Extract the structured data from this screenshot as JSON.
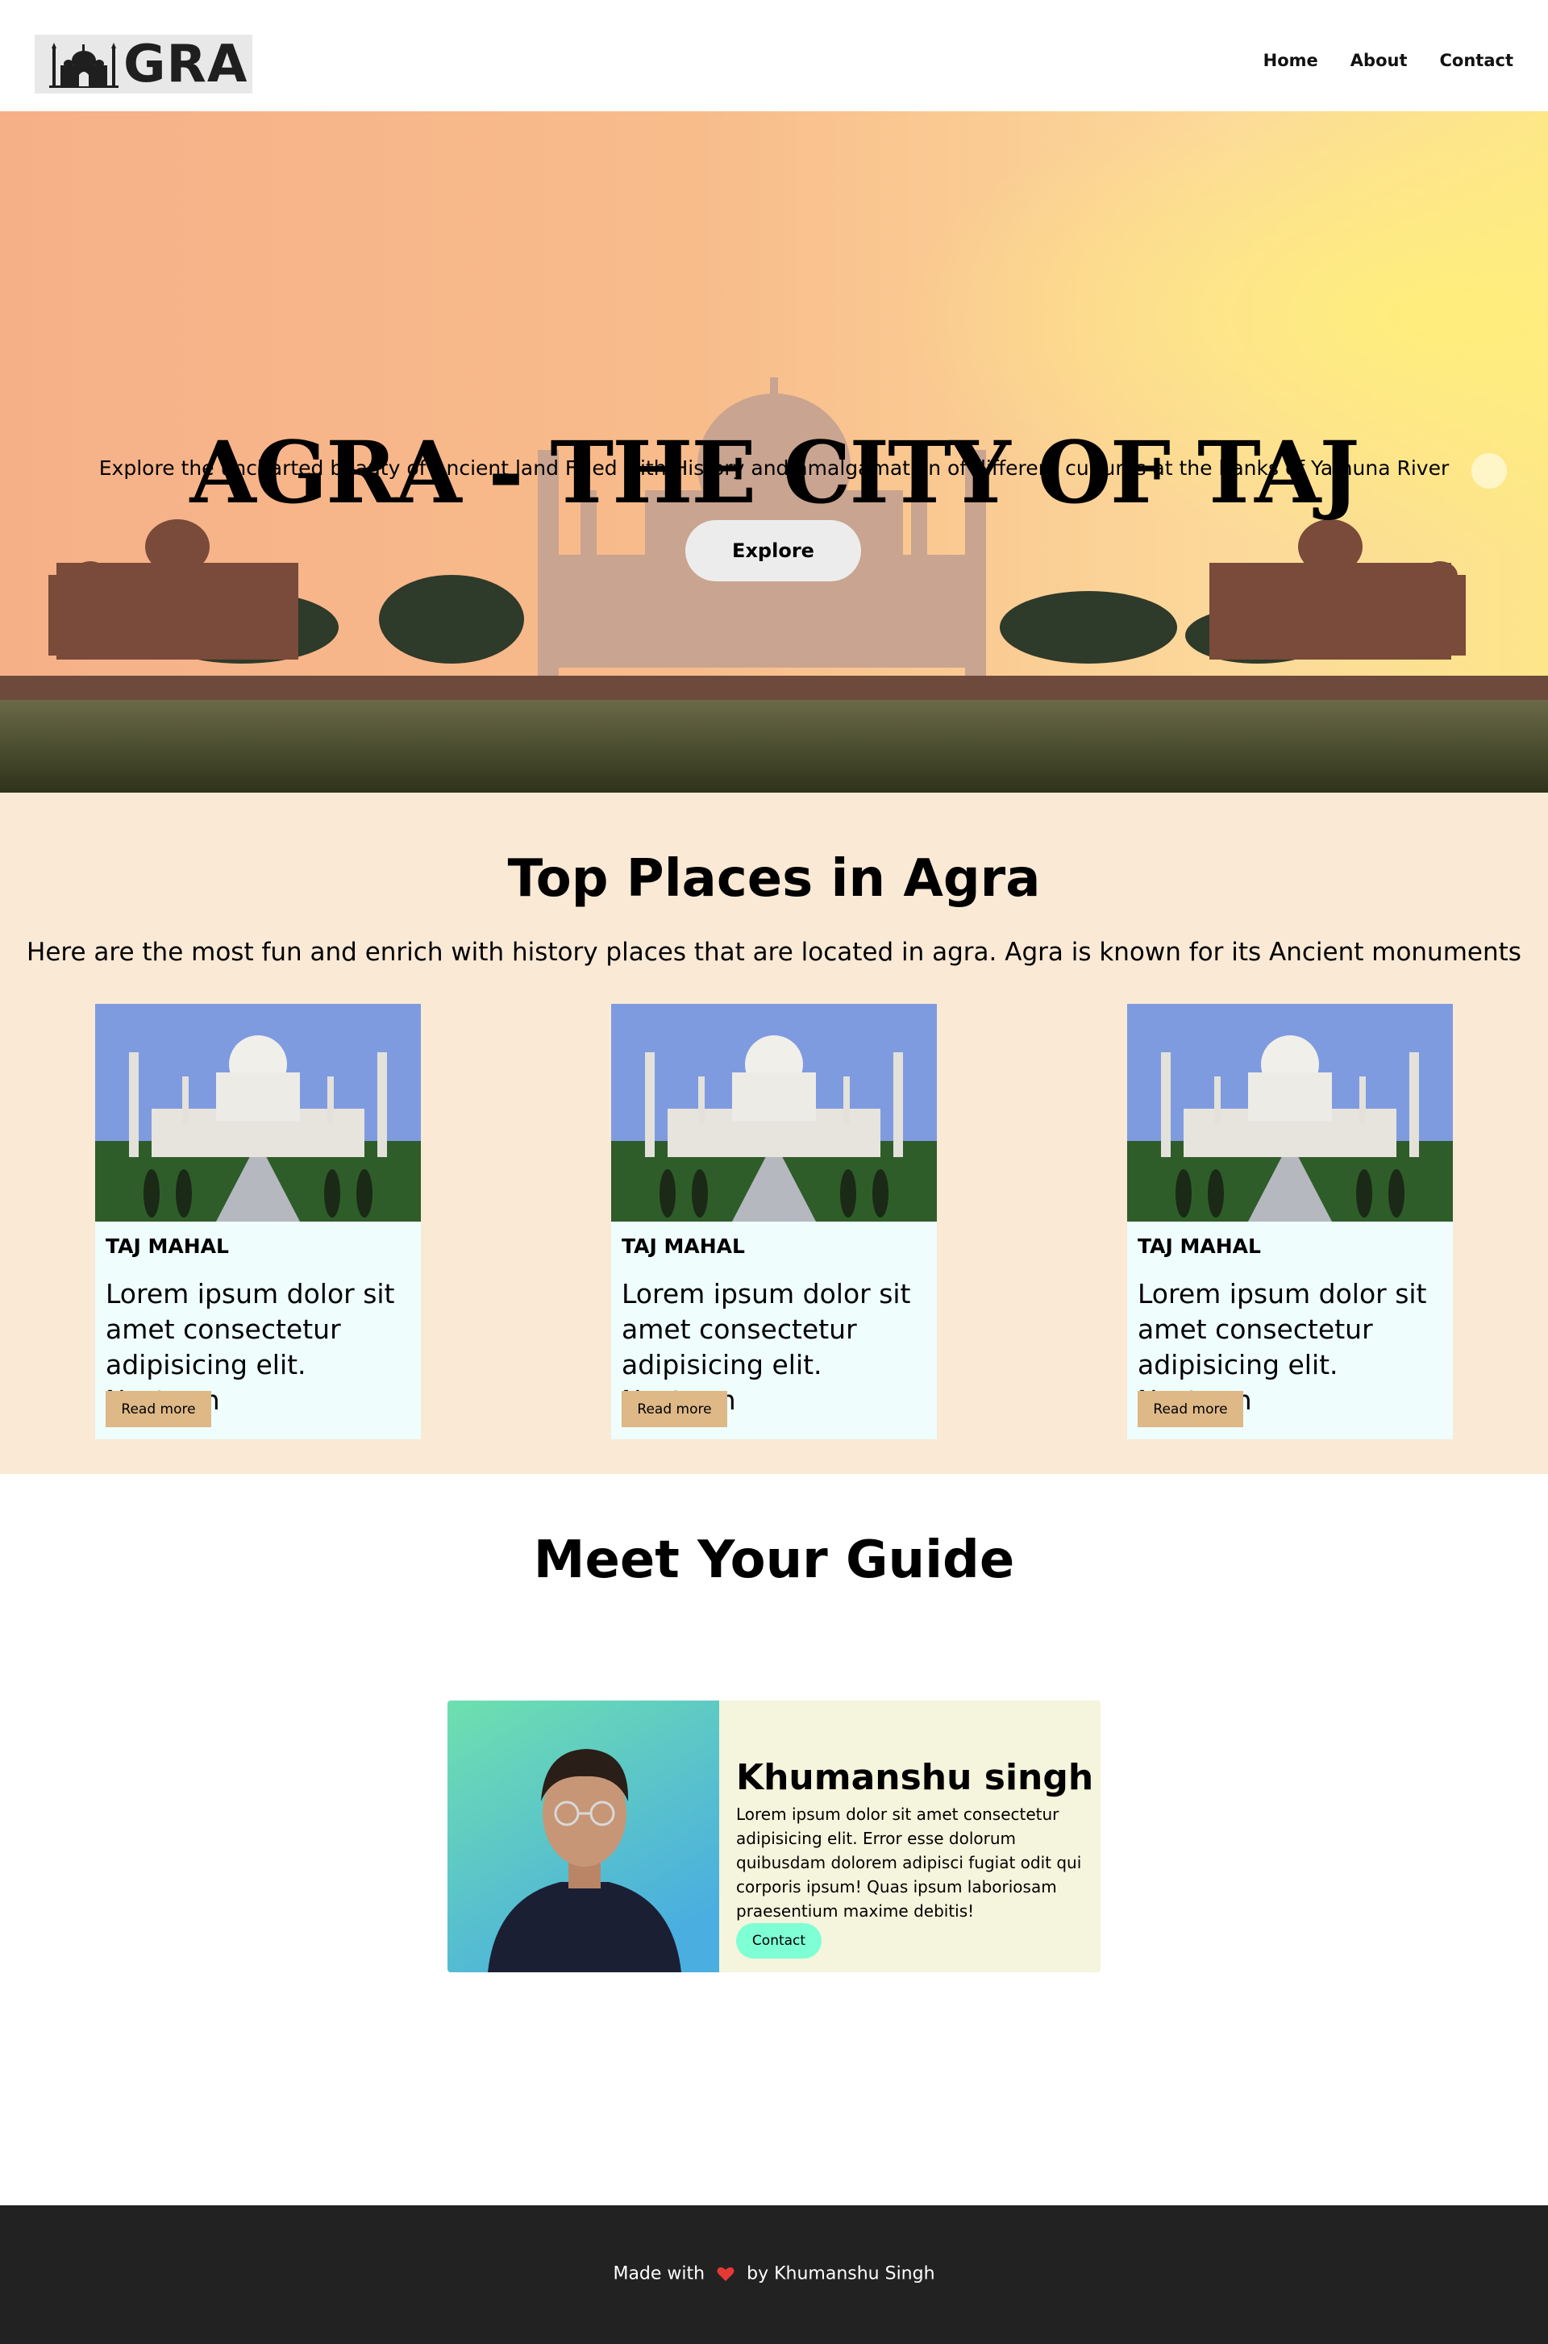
{
  "header": {
    "logo_text": "GRA",
    "nav": [
      "Home",
      "About",
      "Contact"
    ]
  },
  "hero": {
    "title": "AGRA - THE CITY OF TAJ",
    "subtitle": "Explore the uncharted beauty of Ancient land Filled with History and amalgamation of different cultures at the banks of Yamuna River",
    "button": "Explore"
  },
  "places": {
    "title": "Top Places in Agra",
    "description": "Here are the most fun and enrich with history places that are located in agra. Agra is known for its Ancient monuments",
    "cards": [
      {
        "name": "TAJ MAHAL",
        "text": "Lorem ipsum dolor sit amet consectetur adipisicing elit. Nostrum",
        "button": "Read more"
      },
      {
        "name": "TAJ MAHAL",
        "text": "Lorem ipsum dolor sit amet consectetur adipisicing elit. Nostrum",
        "button": "Read more"
      },
      {
        "name": "TAJ MAHAL",
        "text": "Lorem ipsum dolor sit amet consectetur adipisicing elit. Nostrum",
        "button": "Read more"
      }
    ]
  },
  "guide": {
    "title": "Meet Your Guide",
    "name": "Khumanshu singh",
    "bio": "Lorem ipsum dolor sit amet consectetur adipisicing elit. Error esse dolorum quibusdam dolorem adipisci fugiat odit qui corporis ipsum! Quas ipsum laboriosam praesentium maxime debitis!",
    "button": "Contact"
  },
  "footer": {
    "prefix": "Made with",
    "suffix": "by Khumanshu Singh"
  },
  "colors": {
    "places_bg": "#f9e9d5",
    "card_bg": "#effefd",
    "read_more_btn": "#deb887",
    "guide_card_bg": "#f5f4dc",
    "contact_btn": "#7fffd4",
    "footer_bg": "#222222",
    "heart": "#e53935"
  },
  "icons": [
    "taj-mahal-logo-icon",
    "heart-icon"
  ]
}
